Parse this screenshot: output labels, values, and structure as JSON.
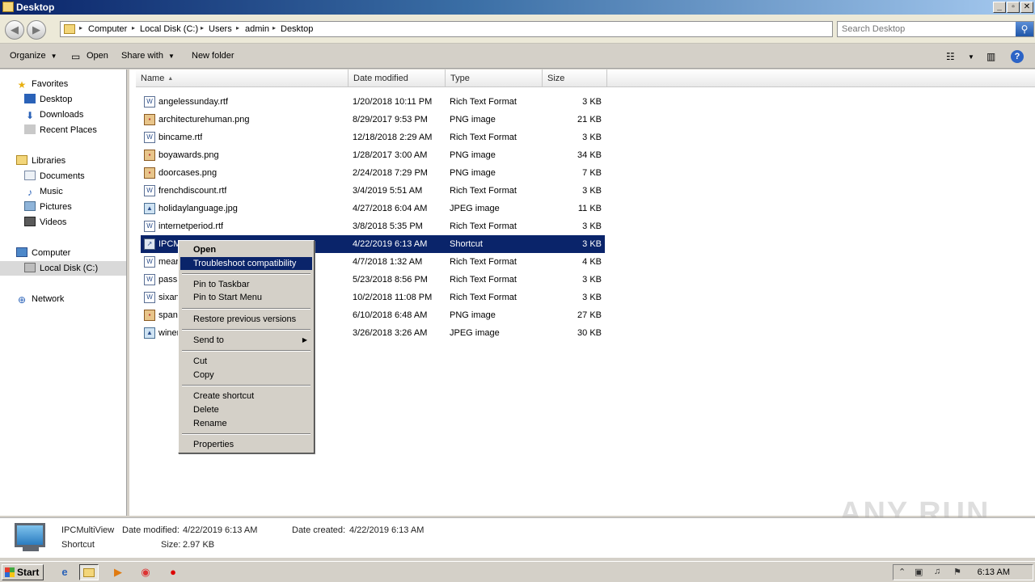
{
  "window": {
    "title": "Desktop",
    "minimize": "_",
    "maximize": "▫",
    "close": "✕"
  },
  "address": {
    "back": "◀",
    "forward": "▶",
    "breadcrumbs": [
      "Computer",
      "Local Disk (C:)",
      "Users",
      "admin",
      "Desktop"
    ],
    "search_placeholder": "Search Desktop"
  },
  "toolbar": {
    "organize": "Organize",
    "open": "Open",
    "share_with": "Share with",
    "new_folder": "New folder"
  },
  "nav": {
    "favorites": "Favorites",
    "desktop": "Desktop",
    "downloads": "Downloads",
    "recent_places": "Recent Places",
    "libraries": "Libraries",
    "documents": "Documents",
    "music": "Music",
    "pictures": "Pictures",
    "videos": "Videos",
    "computer": "Computer",
    "local_disk": "Local Disk (C:)",
    "network": "Network"
  },
  "columns": {
    "name": "Name",
    "date_modified": "Date modified",
    "type": "Type",
    "size": "Size"
  },
  "files": [
    {
      "name": "angelessunday.rtf",
      "date": "1/20/2018 10:11 PM",
      "type": "Rich Text Format",
      "size": "3 KB",
      "icon": "rtf"
    },
    {
      "name": "architecturehuman.png",
      "date": "8/29/2017 9:53 PM",
      "type": "PNG image",
      "size": "21 KB",
      "icon": "png"
    },
    {
      "name": "bincame.rtf",
      "date": "12/18/2018 2:29 AM",
      "type": "Rich Text Format",
      "size": "3 KB",
      "icon": "rtf"
    },
    {
      "name": "boyawards.png",
      "date": "1/28/2017 3:00 AM",
      "type": "PNG image",
      "size": "34 KB",
      "icon": "png"
    },
    {
      "name": "doorcases.png",
      "date": "2/24/2018 7:29 PM",
      "type": "PNG image",
      "size": "7 KB",
      "icon": "png"
    },
    {
      "name": "frenchdiscount.rtf",
      "date": "3/4/2019 5:51 AM",
      "type": "Rich Text Format",
      "size": "3 KB",
      "icon": "rtf"
    },
    {
      "name": "holidaylanguage.jpg",
      "date": "4/27/2018 6:04 AM",
      "type": "JPEG image",
      "size": "11 KB",
      "icon": "jpg"
    },
    {
      "name": "internetperiod.rtf",
      "date": "3/8/2018 5:35 PM",
      "type": "Rich Text Format",
      "size": "3 KB",
      "icon": "rtf"
    },
    {
      "name": "IPCM",
      "date": "4/22/2019 6:13 AM",
      "type": "Shortcut",
      "size": "3 KB",
      "icon": "lnk",
      "selected": true
    },
    {
      "name": "mear",
      "date": "4/7/2018 1:32 AM",
      "type": "Rich Text Format",
      "size": "4 KB",
      "icon": "rtf"
    },
    {
      "name": "passi",
      "date": "5/23/2018 8:56 PM",
      "type": "Rich Text Format",
      "size": "3 KB",
      "icon": "rtf"
    },
    {
      "name": "sixan",
      "date": "10/2/2018 11:08 PM",
      "type": "Rich Text Format",
      "size": "3 KB",
      "icon": "rtf"
    },
    {
      "name": "span",
      "date": "6/10/2018 6:48 AM",
      "type": "PNG image",
      "size": "27 KB",
      "icon": "png"
    },
    {
      "name": "winer",
      "date": "3/26/2018 3:26 AM",
      "type": "JPEG image",
      "size": "30 KB",
      "icon": "jpg"
    }
  ],
  "context_menu": {
    "open": "Open",
    "troubleshoot": "Troubleshoot compatibility",
    "pin_taskbar": "Pin to Taskbar",
    "pin_start": "Pin to Start Menu",
    "restore": "Restore previous versions",
    "send_to": "Send to",
    "cut": "Cut",
    "copy": "Copy",
    "create_shortcut": "Create shortcut",
    "delete": "Delete",
    "rename": "Rename",
    "properties": "Properties"
  },
  "details": {
    "name": "IPCMultiView",
    "type": "Shortcut",
    "date_modified_label": "Date modified:",
    "date_modified": "4/22/2019 6:13 AM",
    "date_created_label": "Date created:",
    "date_created": "4/22/2019 6:13 AM",
    "size_label": "Size:",
    "size": "2.97 KB"
  },
  "watermark": "ANY RUN",
  "taskbar": {
    "start": "Start",
    "clock": "6:13 AM"
  },
  "colors": {
    "selection": "#0a246a",
    "face": "#d4d0c8"
  }
}
